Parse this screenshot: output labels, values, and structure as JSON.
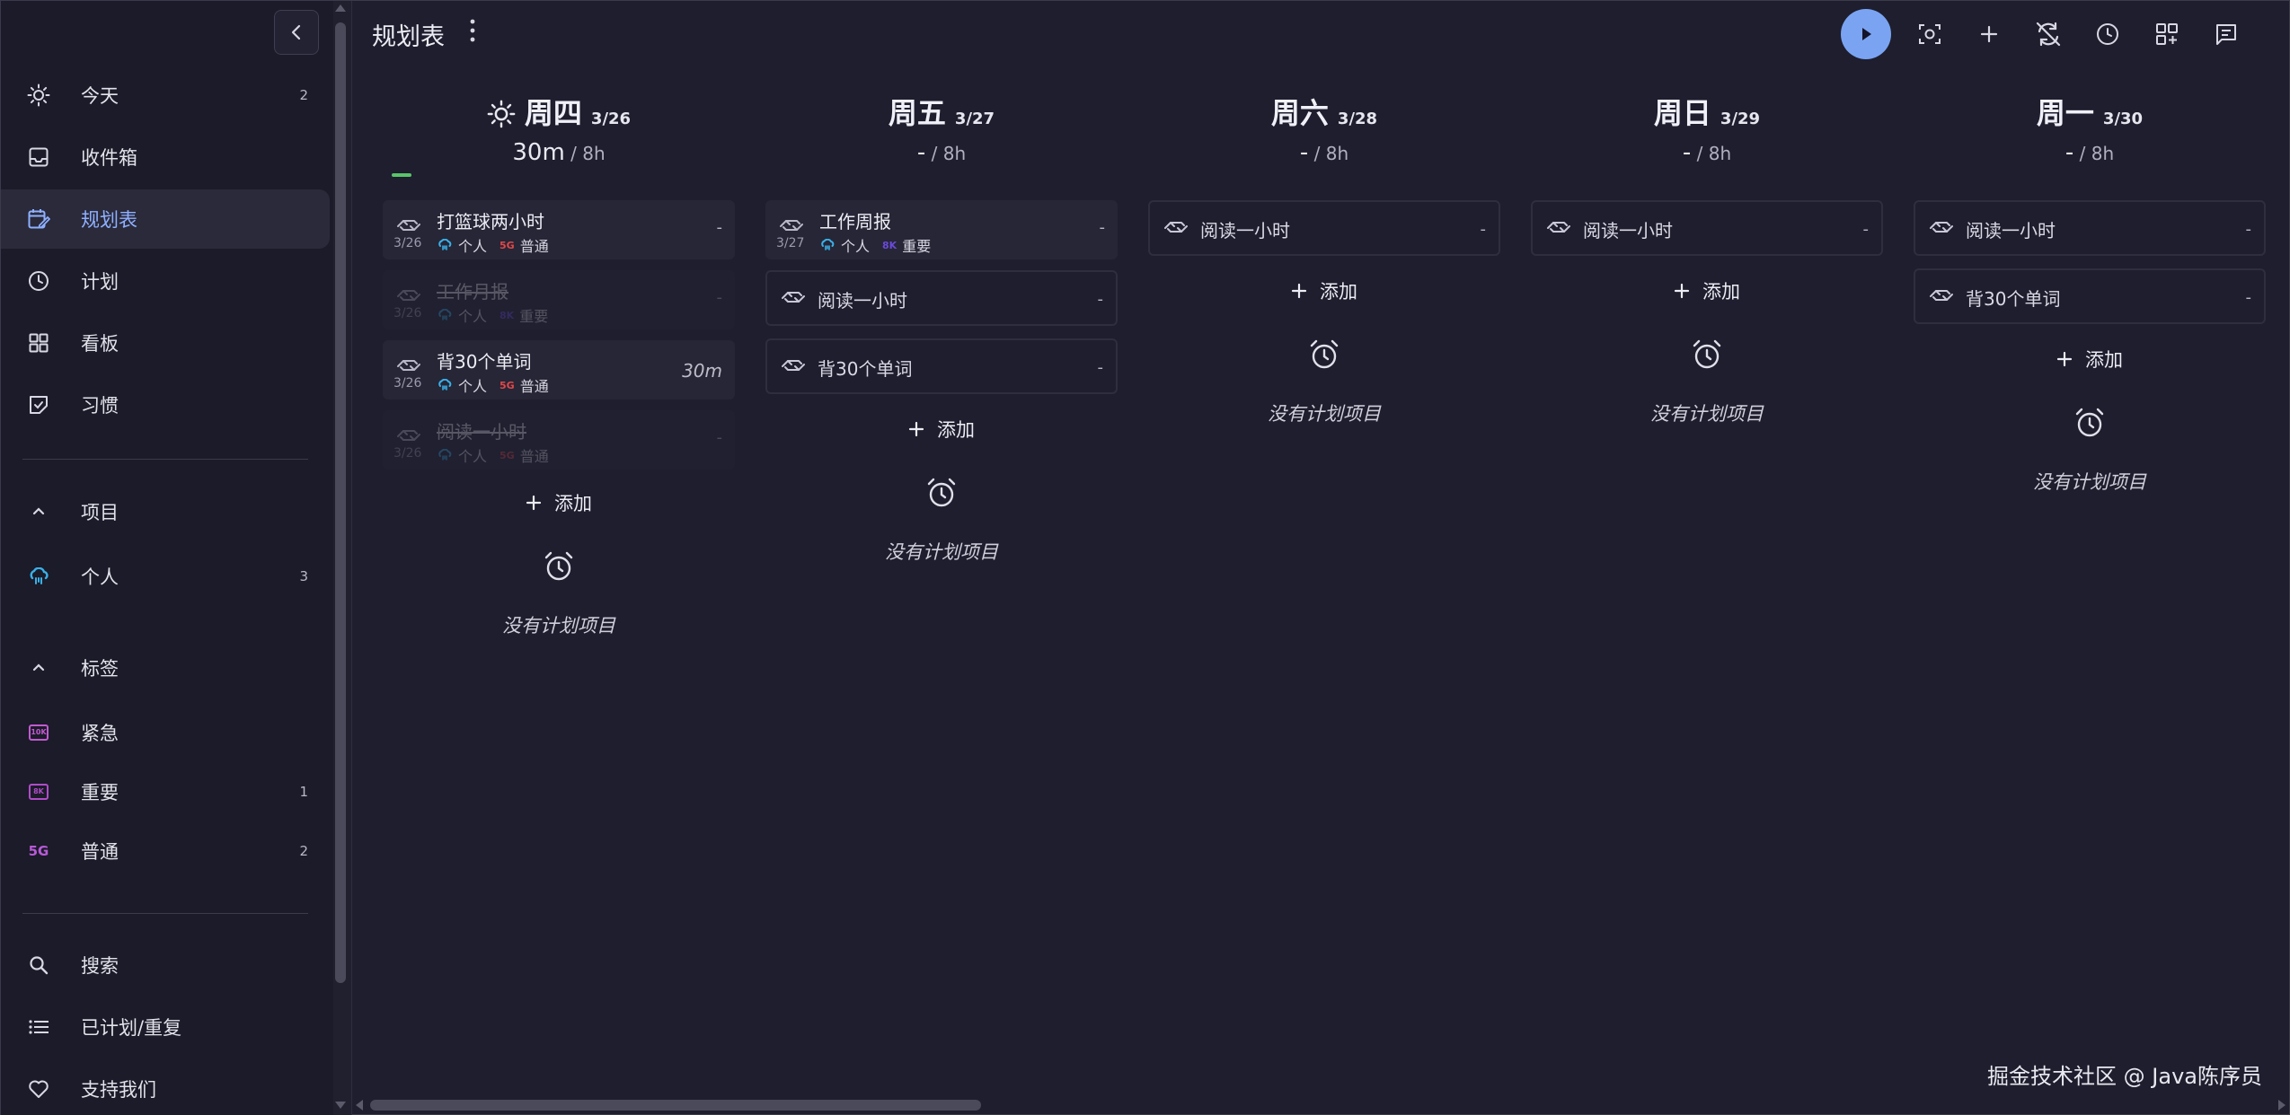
{
  "sidebar": {
    "nav": [
      {
        "label": "今天",
        "count": "2",
        "icon": "sun-icon"
      },
      {
        "label": "收件箱",
        "count": "",
        "icon": "inbox-icon"
      },
      {
        "label": "规划表",
        "count": "",
        "icon": "planner-icon",
        "active": true
      },
      {
        "label": "计划",
        "count": "",
        "icon": "clock-icon"
      },
      {
        "label": "看板",
        "count": "",
        "icon": "kanban-icon"
      },
      {
        "label": "习惯",
        "count": "",
        "icon": "habit-icon"
      }
    ],
    "projects_header": "项目",
    "projects": [
      {
        "label": "个人",
        "count": "3",
        "icon": "cloud-icon"
      }
    ],
    "tags_header": "标签",
    "tags": [
      {
        "label": "紧急",
        "count": "",
        "badge": "10K",
        "color": "#c25ad0"
      },
      {
        "label": "重要",
        "count": "1",
        "badge": "8K",
        "color": "#b04cc8"
      },
      {
        "label": "普通",
        "count": "2",
        "badge": "5G",
        "color": "#b85ad8"
      }
    ],
    "bottom": [
      {
        "label": "搜索",
        "icon": "search-icon"
      },
      {
        "label": "已计划/重复",
        "icon": "list-icon"
      },
      {
        "label": "支持我们",
        "icon": "heart-icon"
      }
    ]
  },
  "header": {
    "title": "规划表"
  },
  "columns": [
    {
      "day": "周四",
      "date": "3/26",
      "time_big": "30m",
      "time_total": "/ 8h",
      "has_sun": true,
      "tasks": [
        {
          "title": "打篮球两小时",
          "date": "3/26",
          "project": "个人",
          "tag": "普通",
          "tagcode": "5G",
          "tagcolor": "#e04848",
          "right": "-",
          "done": false
        },
        {
          "title": "工作月报",
          "date": "3/26",
          "project": "个人",
          "tag": "重要",
          "tagcode": "8K",
          "tagcolor": "#6a4ad8",
          "right": "-",
          "done": true
        },
        {
          "title": "背30个单词",
          "date": "3/26",
          "project": "个人",
          "tag": "普通",
          "tagcode": "5G",
          "tagcolor": "#e04848",
          "right": "30m",
          "done": false
        },
        {
          "title": "阅读一小时",
          "date": "3/26",
          "project": "个人",
          "tag": "普通",
          "tagcode": "5G",
          "tagcolor": "#e04848",
          "right": "-",
          "done": true
        }
      ],
      "add": "添加",
      "empty": "没有计划项目"
    },
    {
      "day": "周五",
      "date": "3/27",
      "time_big": "-",
      "time_total": "/ 8h",
      "tasks": [
        {
          "title": "工作周报",
          "date": "3/27",
          "project": "个人",
          "tag": "重要",
          "tagcode": "8K",
          "tagcolor": "#6a4ad8",
          "right": "-"
        }
      ],
      "singles": [
        "阅读一小时",
        "背30个单词"
      ],
      "add": "添加",
      "empty": "没有计划项目"
    },
    {
      "day": "周六",
      "date": "3/28",
      "time_big": "-",
      "time_total": "/ 8h",
      "singles": [
        "阅读一小时"
      ],
      "add": "添加",
      "empty": "没有计划项目"
    },
    {
      "day": "周日",
      "date": "3/29",
      "time_big": "-",
      "time_total": "/ 8h",
      "singles": [
        "阅读一小时"
      ],
      "add": "添加",
      "empty": "没有计划项目"
    },
    {
      "day": "周一",
      "date": "3/30",
      "time_big": "-",
      "time_total": "/ 8h",
      "singles": [
        "阅读一小时",
        "背30个单词"
      ],
      "add": "添加",
      "empty": "没有计划项目"
    }
  ],
  "watermark": "掘金技术社区 @ Java陈序员",
  "colors": {
    "accent": "#7aa4f2",
    "active_text": "#8fb0ff",
    "progress": "#5ac46a"
  }
}
